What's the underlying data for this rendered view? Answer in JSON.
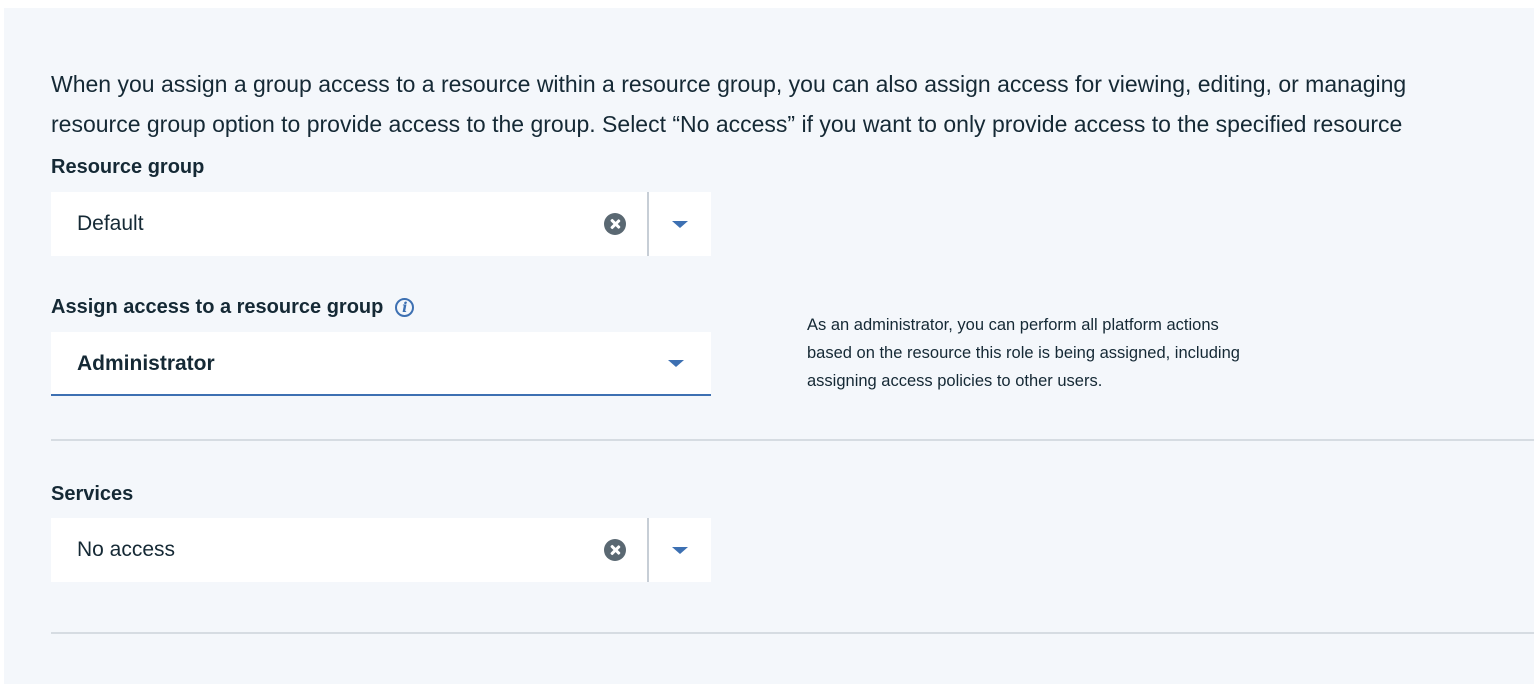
{
  "intro": {
    "line1": "When you assign a group access to a resource within a resource group, you can also assign access for viewing, editing, or managing",
    "line2": "resource group option to provide access to the group. Select “No access” if you want to only provide access to the specified resource"
  },
  "resource_group": {
    "label": "Resource group",
    "value": "Default"
  },
  "assign_access": {
    "label": "Assign access to a resource group",
    "info_icon": "info-icon",
    "value": "Administrator",
    "description": "As an administrator, you can perform all platform actions based on the resource this role is being assigned, including assigning access policies to other users."
  },
  "services": {
    "label": "Services",
    "value": "No access"
  },
  "colors": {
    "panel_bg": "#f4f7fb",
    "accent": "#3d70b2",
    "text": "#152935"
  }
}
